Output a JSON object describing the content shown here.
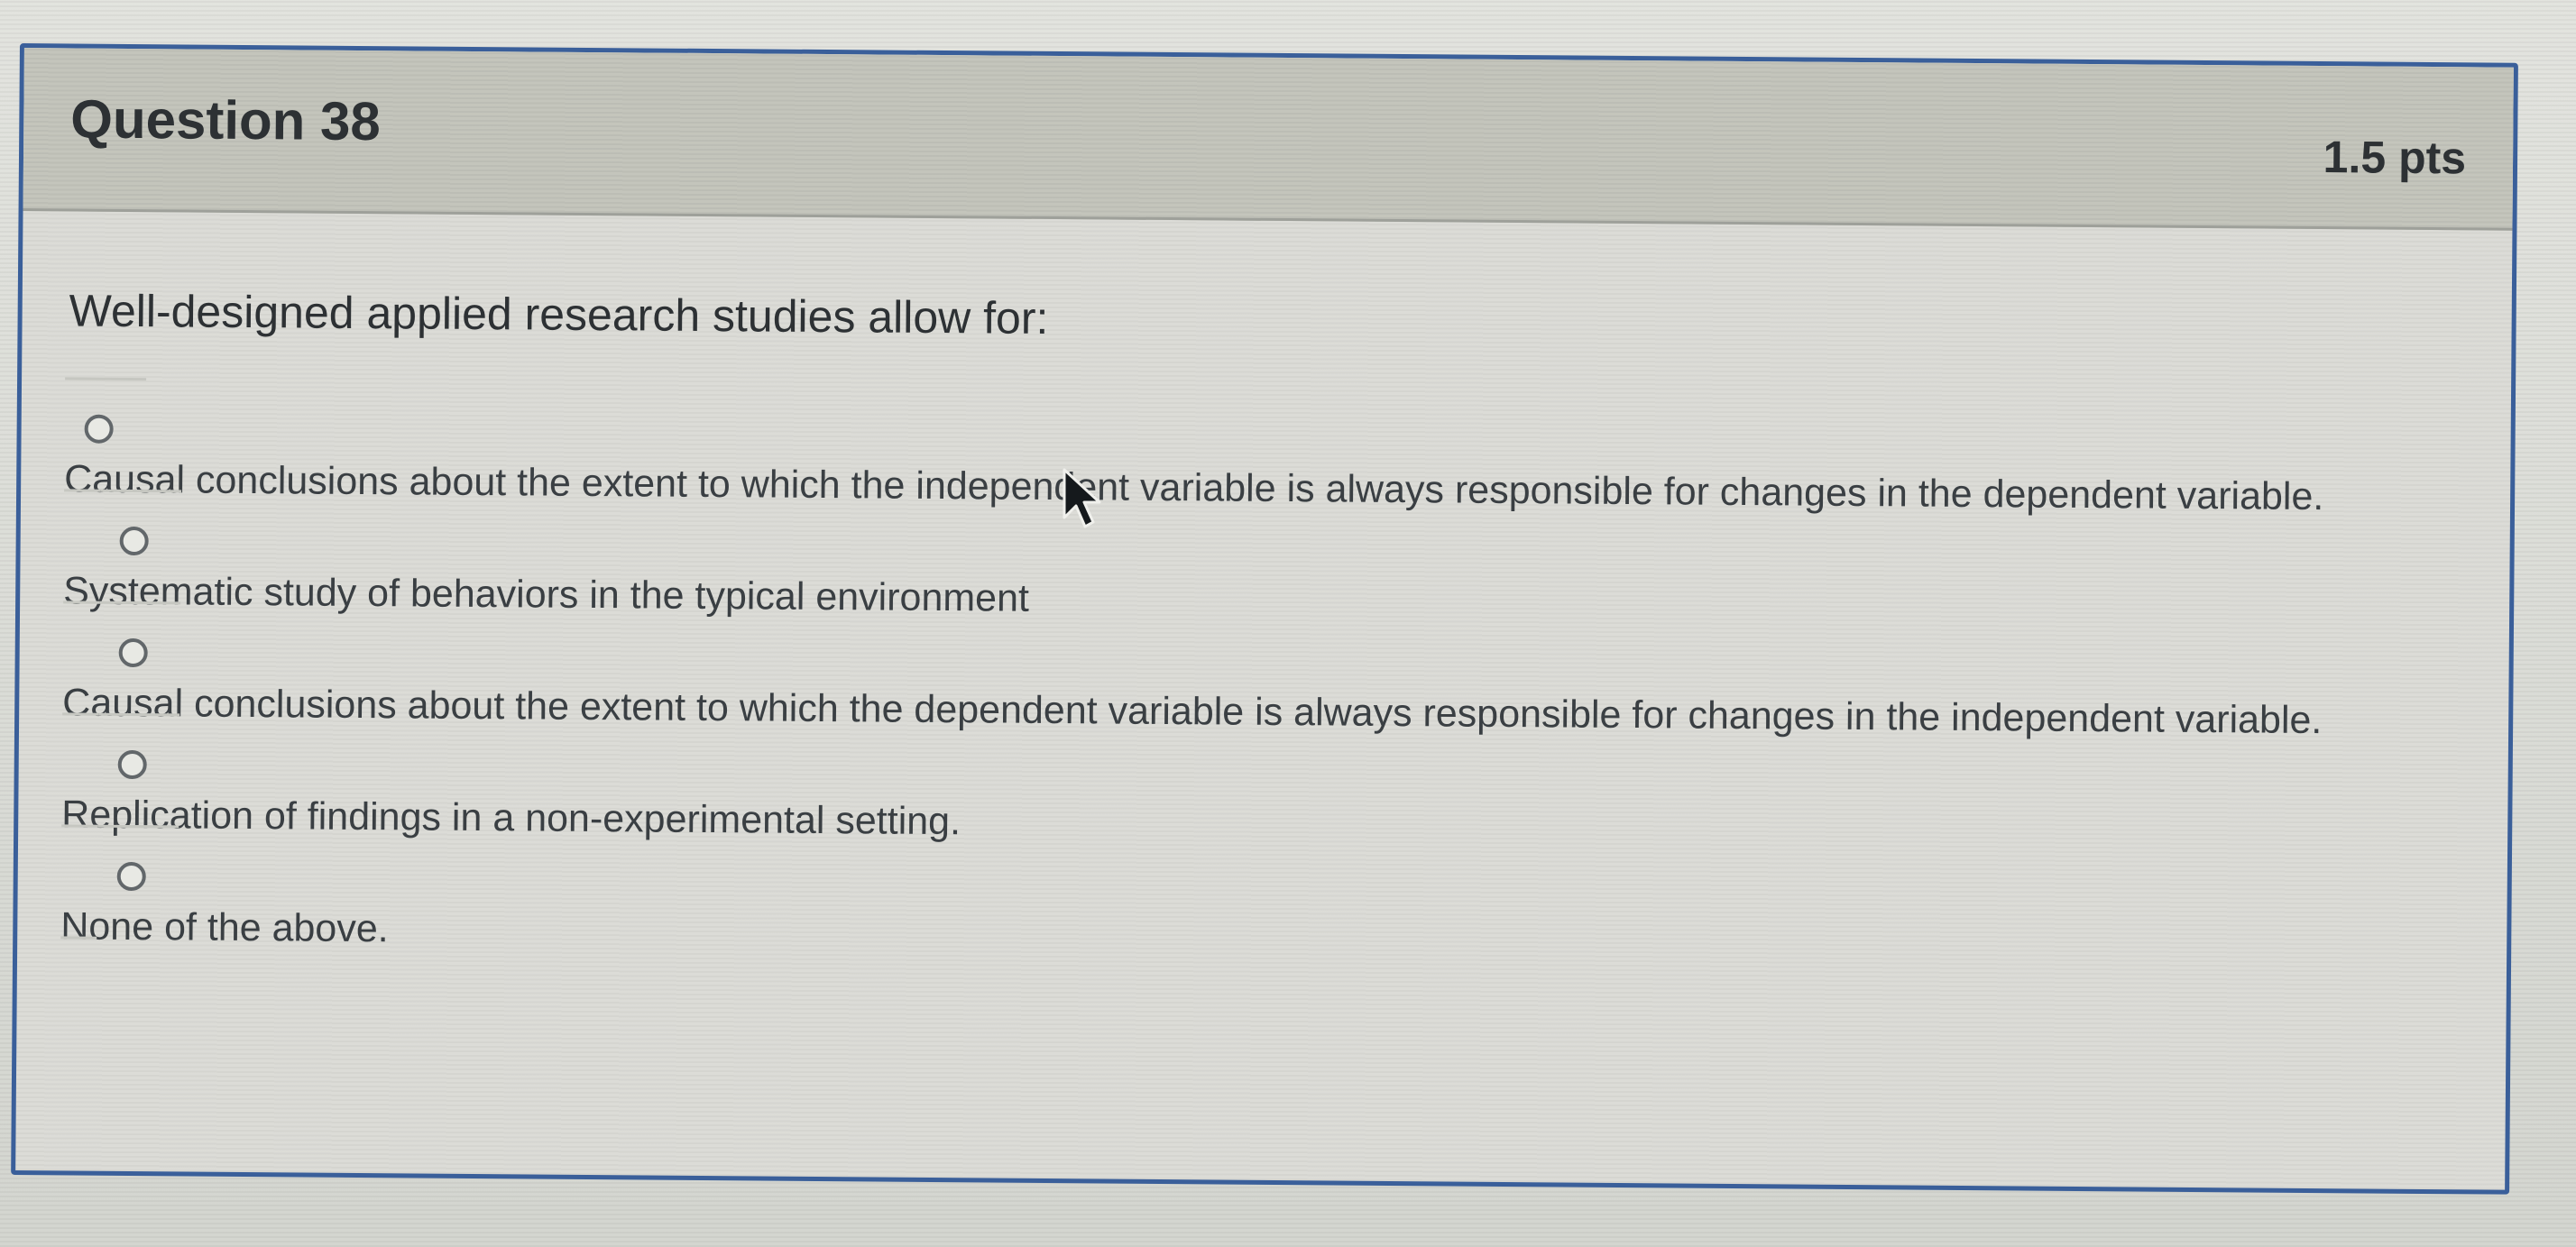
{
  "question": {
    "title": "Question 38",
    "points": "1.5 pts",
    "text": "Well-designed applied research studies allow for:",
    "options": [
      "Causal conclusions about the extent to which the independent variable is always responsible for changes in the dependent variable.",
      "Systematic study of behaviors in the typical environment",
      "Causal conclusions about the extent to which the dependent variable is always responsible for changes in the independent variable.",
      "Replication of findings in a non-experimental setting.",
      "None of the above."
    ]
  },
  "icons": {
    "radio": "radio-button-icon",
    "cursor": "mouse-pointer-icon"
  },
  "colors": {
    "border": "#3a5f9a",
    "header_background": "#c4c5bc",
    "text": "#2d3134"
  }
}
